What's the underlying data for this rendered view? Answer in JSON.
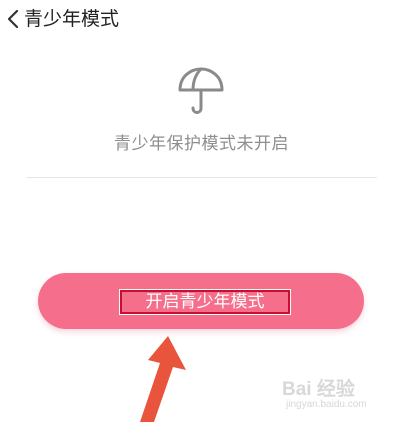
{
  "header": {
    "back_icon": "chevron-left-icon",
    "title": "青少年模式"
  },
  "main": {
    "icon": "umbrella-icon",
    "status_text": "青少年保护模式未开启"
  },
  "action": {
    "enable_label": "开启青少年模式",
    "button_color": "#f56f8c",
    "highlight_color": "#c8102e"
  },
  "annotation": {
    "arrow_color": "#e8543c"
  },
  "watermark": {
    "text": "Bai 经验",
    "sub": "jingyan.baidu.com"
  }
}
